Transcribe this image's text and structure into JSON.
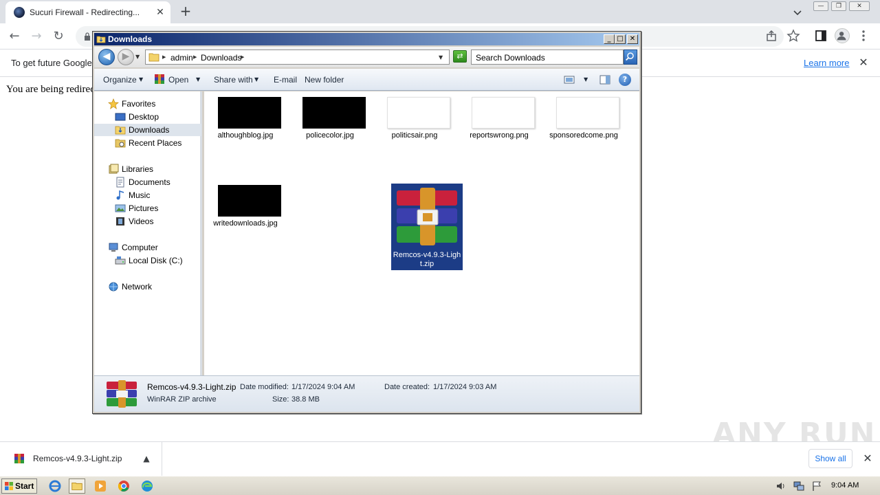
{
  "browser": {
    "tab_title": "Sucuri Firewall - Redirecting...",
    "tab_close": "✕",
    "new_tab": "+",
    "back": "←",
    "forward": "→",
    "reload": "↻",
    "infobar_text": "To get future Google",
    "learn_more": "Learn more",
    "infobar_close": "✕",
    "page_text": "You are being redirec"
  },
  "downloads_shelf": {
    "file_name": "Remcos-v4.9.3-Light.zip",
    "chevron": "▲",
    "show_all": "Show all",
    "close": "✕"
  },
  "watermark": "ANY RUN",
  "explorer": {
    "title": "Downloads",
    "min": "_",
    "max": "□",
    "close": "✕",
    "breadcrumbs": [
      "admin",
      "Downloads"
    ],
    "search_placeholder": "Search Downloads",
    "commands": {
      "organize": "Organize",
      "open": "Open",
      "share_with": "Share with",
      "email": "E-mail",
      "new_folder": "New folder"
    },
    "nav": {
      "favorites": "Favorites",
      "desktop": "Desktop",
      "downloads": "Downloads",
      "recent_places": "Recent Places",
      "libraries": "Libraries",
      "documents": "Documents",
      "music": "Music",
      "pictures": "Pictures",
      "videos": "Videos",
      "computer": "Computer",
      "local_disk": "Local Disk (C:)",
      "network": "Network"
    },
    "files": [
      {
        "name": "althoughblog.jpg",
        "thumb": "black"
      },
      {
        "name": "policecolor.jpg",
        "thumb": "black"
      },
      {
        "name": "politicsair.png",
        "thumb": "white"
      },
      {
        "name": "reportswrong.png",
        "thumb": "white"
      },
      {
        "name": "sponsoredcome.png",
        "thumb": "white"
      },
      {
        "name": "writedownloads.jpg",
        "thumb": "black"
      },
      {
        "name": "Remcos-v4.9.3-Light.zip",
        "thumb": "winrar",
        "selected": true
      }
    ],
    "details": {
      "name": "Remcos-v4.9.3-Light.zip",
      "type": "WinRAR ZIP archive",
      "modified_label": "Date modified:",
      "modified_value": "1/17/2024 9:04 AM",
      "size_label": "Size:",
      "size_value": "38.8 MB",
      "created_label": "Date created:",
      "created_value": "1/17/2024 9:03 AM"
    }
  },
  "taskbar": {
    "start": "Start",
    "clock": "9:04 AM"
  },
  "colors": {
    "selection": "#1c3c86",
    "titlebar_start": "#0a246a",
    "link": "#1a73e8"
  }
}
